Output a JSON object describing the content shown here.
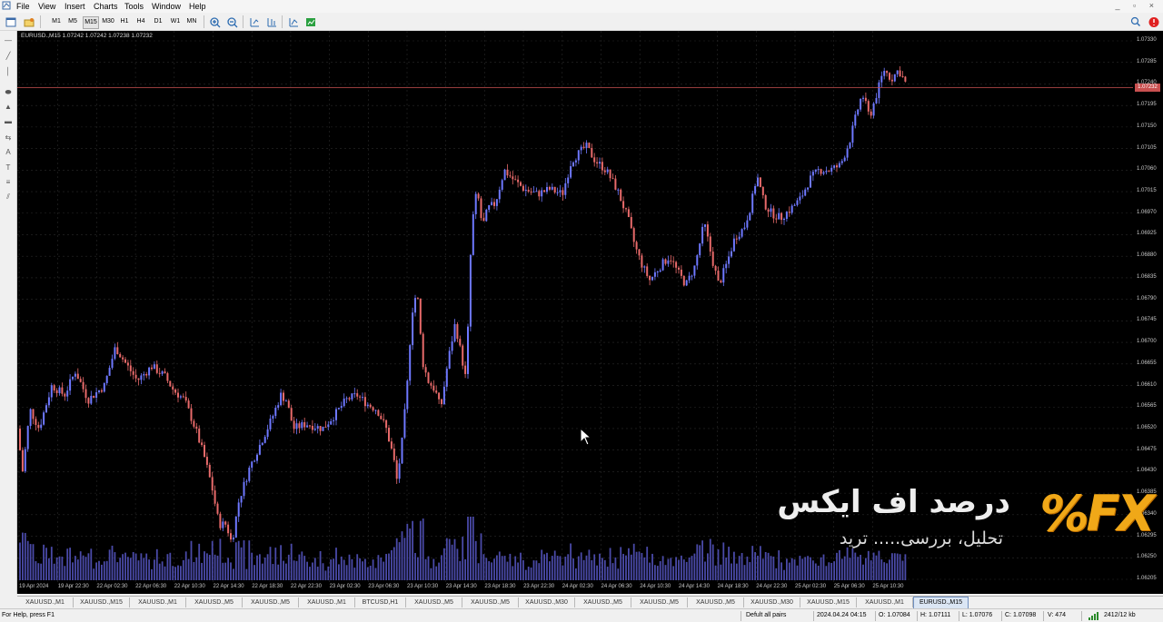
{
  "menu": [
    "File",
    "View",
    "Insert",
    "Charts",
    "Tools",
    "Window",
    "Help"
  ],
  "toolbar": {
    "timeframes": [
      "M1",
      "M5",
      "M15",
      "M30",
      "H1",
      "H4",
      "D1",
      "W1",
      "MN"
    ],
    "active_timeframe": "M15"
  },
  "chart": {
    "header": "EURUSD.,M15  1.07242 1.07242 1.07238 1.07232",
    "current_price": "1.07232",
    "bull_color": "#6e78ff",
    "bear_color": "#e86a6a",
    "price_ticks": [
      "1.07330",
      "1.07285",
      "1.07240",
      "1.07195",
      "1.07150",
      "1.07105",
      "1.07060",
      "1.07015",
      "1.06970",
      "1.06925",
      "1.06880",
      "1.06835",
      "1.06790",
      "1.06745",
      "1.06700",
      "1.06655",
      "1.06610",
      "1.06565",
      "1.06520",
      "1.06475",
      "1.06430",
      "1.06385",
      "1.06340",
      "1.06295",
      "1.06250",
      "1.06205"
    ],
    "time_ticks": [
      "19 Apr 2024",
      "19 Apr 22:30",
      "22 Apr 02:30",
      "22 Apr 06:30",
      "22 Apr 10:30",
      "22 Apr 14:30",
      "22 Apr 18:30",
      "22 Apr 22:30",
      "23 Apr 02:30",
      "23 Apr 06:30",
      "23 Apr 10:30",
      "23 Apr 14:30",
      "23 Apr 18:30",
      "23 Apr 22:30",
      "24 Apr 02:30",
      "24 Apr 06:30",
      "24 Apr 10:30",
      "24 Apr 14:30",
      "24 Apr 18:30",
      "24 Apr 22:30",
      "25 Apr 02:30",
      "25 Apr 06:30",
      "25 Apr 10:30"
    ]
  },
  "tabs": [
    "XAUUSD.,M1",
    "XAUUSD.,M15",
    "XAUUSD.,M1",
    "XAUUSD.,M5",
    "XAUUSD.,M5",
    "XAUUSD.,M1",
    "BTCUSD,H1",
    "XAUUSD.,M5",
    "XAUUSD.,M5",
    "XAUUSD.,M30",
    "XAUUSD.,M5",
    "XAUUSD.,M5",
    "XAUUSD.,M5",
    "XAUUSD.,M30",
    "XAUUSD.,M15",
    "XAUUSD.,M1",
    "EURUSD.,M15"
  ],
  "active_tab": "EURUSD.,M15",
  "status": {
    "help": "For Help, press F1",
    "profile": "Defult all pairs",
    "datetime": "2024.04.24 04:15",
    "open": "O: 1.07084",
    "high": "H: 1.07111",
    "low": "L: 1.07076",
    "close": "C: 1.07098",
    "volume": "V: 474",
    "traffic": "2412/12 kb"
  },
  "watermark": {
    "title": "درصد اف ایکس",
    "subtitle": "تحلیل، بررسی..... ترید",
    "logo": "%FX"
  }
}
